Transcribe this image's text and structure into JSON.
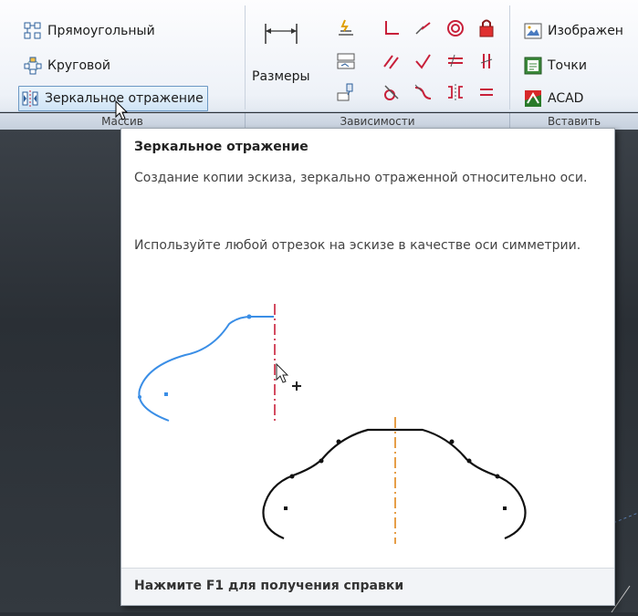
{
  "ribbon": {
    "pattern": {
      "rectangular_label": "Прямоугольный",
      "circular_label": "Круговой",
      "mirror_label": "Зеркальное отражение",
      "panel_label": "Массив"
    },
    "constraints": {
      "dimension_label": "Размеры",
      "panel_label": "Зависимости"
    },
    "insert": {
      "image_label": "Изображен",
      "points_label": "Точки",
      "acad_label": "ACAD",
      "panel_label": "Вставить"
    }
  },
  "tooltip": {
    "title": "Зеркальное отражение",
    "description": "Создание копии эскиза, зеркально отраженной относительно оси.",
    "hint": "Используйте любой отрезок на эскизе в качестве оси симметрии.",
    "footer": "Нажмите F1 для получения справки"
  },
  "colors": {
    "sketch_blue": "#3a8ee6",
    "axis_red": "#c8203a",
    "axis_orange": "#e0861a",
    "ribbon_active": "#cfe4f6"
  }
}
